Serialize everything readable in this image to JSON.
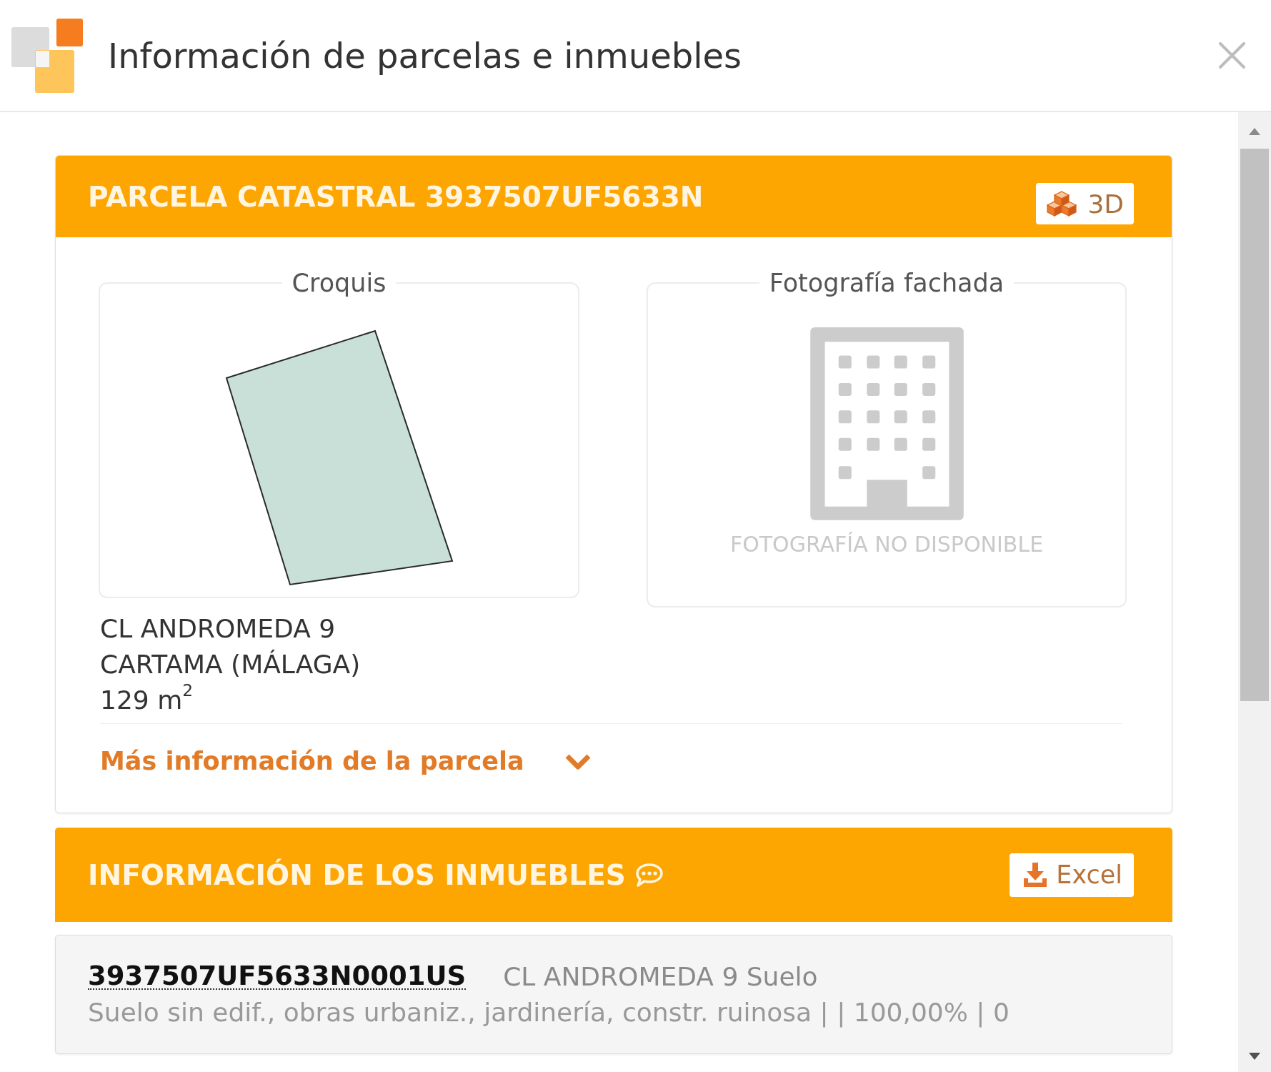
{
  "window": {
    "title": "Información de parcelas e inmuebles"
  },
  "parcel": {
    "title": "PARCELA CATASTRAL 3937507UF5633N",
    "button_3d": "3D",
    "sketch": {
      "title": "Croquis"
    },
    "facade_photo": {
      "title": "Fotografía fachada",
      "message": "FOTOGRAFÍA NO DISPONIBLE"
    },
    "address_lines": [
      "CL ANDROMEDA 9",
      "CARTAMA (MÁLAGA)"
    ],
    "area": "129 m$^{2}$",
    "more_info": {
      "label": "Más información de la parcela",
      "expanded": false
    }
  },
  "properties": {
    "title": "INFORMACIÓN DE LOS INMUEBLES",
    "export_button": "Excel",
    "items": [
      {
        "reference": "3937507UF5633N0001US",
        "address": "CL ANDROMEDA 9 Suelo",
        "details": "Suelo sin edif., obras urbaniz., jardinería, constr. ruinosa | | 100,00% | 0"
      }
    ]
  }
}
